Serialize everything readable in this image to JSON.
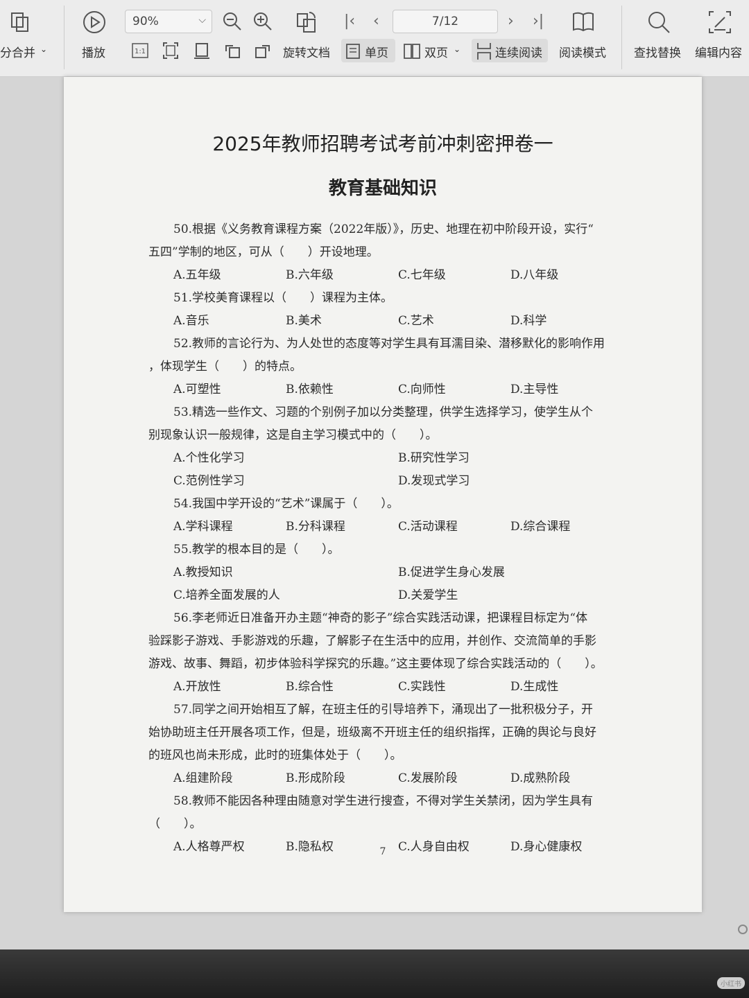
{
  "toolbar": {
    "merge_label": "分合并",
    "play_label": "播放",
    "zoom_value": "90%",
    "rotate_label": "旋转文档",
    "page_indicator": "7/12",
    "single_page_label": "单页",
    "double_page_label": "双页",
    "continuous_label": "连续阅读",
    "reading_mode_label": "阅读模式",
    "find_replace_label": "查找替换",
    "edit_content_label": "编辑内容",
    "actual_size_label": "1:1"
  },
  "document": {
    "title": "2025年教师招聘考试考前冲刺密押卷一",
    "subtitle": "教育基础知识",
    "page_number": "7",
    "questions": [
      {
        "lines": [
          "50.根据《义务教育课程方案（2022年版）》，历史、地理在初中阶段开设，实行“",
          "五四”学制的地区，可从（　　）开设地理。"
        ],
        "options": [
          "A.五年级",
          "B.六年级",
          "C.七年级",
          "D.八年级"
        ]
      },
      {
        "lines": [
          "51.学校美育课程以（　　）课程为主体。"
        ],
        "options": [
          "A.音乐",
          "B.美术",
          "C.艺术",
          "D.科学"
        ]
      },
      {
        "lines": [
          "52.教师的言论行为、为人处世的态度等对学生具有耳濡目染、潜移默化的影响作用",
          "，体现学生（　　）的特点。"
        ],
        "options": [
          "A.可塑性",
          "B.依赖性",
          "C.向师性",
          "D.主导性"
        ]
      },
      {
        "lines": [
          "53.精选一些作文、习题的个别例子加以分类整理，供学生选择学习，使学生从个",
          "别现象认识一般规律，这是自主学习模式中的（　　）。"
        ],
        "options": [
          "A.个性化学习",
          "B.研究性学习",
          "C.范例性学习",
          "D.发现式学习"
        ]
      },
      {
        "lines": [
          "54.我国中学开设的“艺术”课属于（　　）。"
        ],
        "options": [
          "A.学科课程",
          "B.分科课程",
          "C.活动课程",
          "D.综合课程"
        ]
      },
      {
        "lines": [
          "55.教学的根本目的是（　　）。"
        ],
        "options": [
          "A.教授知识",
          "B.促进学生身心发展",
          "C.培养全面发展的人",
          "D.关爱学生"
        ]
      },
      {
        "lines": [
          "56.李老师近日准备开办主题“神奇的影子”综合实践活动课，把课程目标定为“体",
          "验踩影子游戏、手影游戏的乐趣，了解影子在生活中的应用，并创作、交流简单的手影",
          "游戏、故事、舞蹈，初步体验科学探究的乐趣。”这主要体现了综合实践活动的（　　）。"
        ],
        "options": [
          "A.开放性",
          "B.综合性",
          "C.实践性",
          "D.生成性"
        ]
      },
      {
        "lines": [
          "57.同学之间开始相互了解，在班主任的引导培养下，涌现出了一批积极分子，开",
          "始协助班主任开展各项工作，但是，班级离不开班主任的组织指挥，正确的舆论与良好",
          "的班风也尚未形成，此时的班集体处于（　　）。"
        ],
        "options": [
          "A.组建阶段",
          "B.形成阶段",
          "C.发展阶段",
          "D.成熟阶段"
        ]
      },
      {
        "lines": [
          "58.教师不能因各种理由随意对学生进行搜查，不得对学生关禁闭，因为学生具有",
          "（　　）。"
        ],
        "options": [
          "A.人格尊严权",
          "B.隐私权",
          "C.人身自由权",
          "D.身心健康权"
        ]
      }
    ]
  },
  "watermark": "小红书"
}
